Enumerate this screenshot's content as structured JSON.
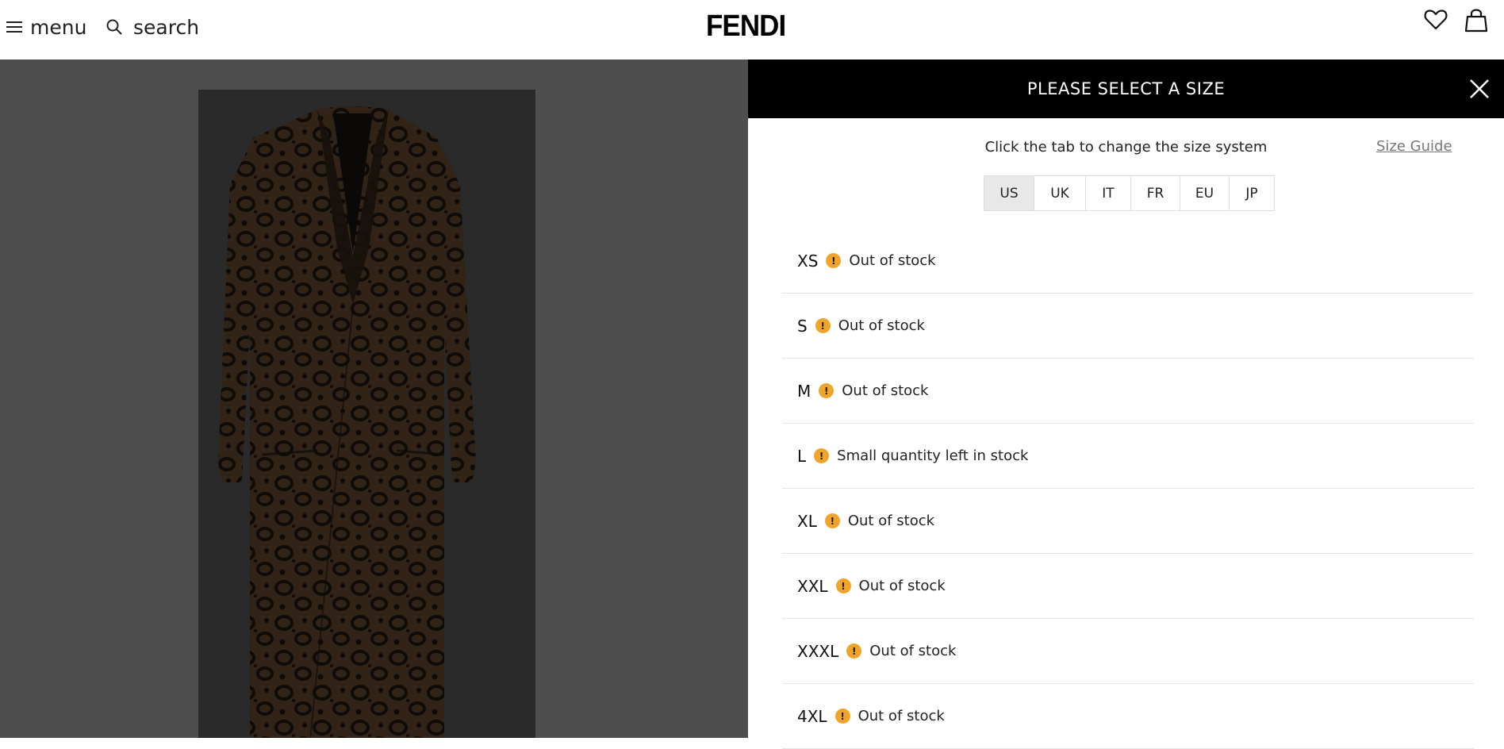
{
  "header": {
    "menu_label": "menu",
    "search_label": "search",
    "logo": "FENDI",
    "icons": [
      "menu-icon",
      "search-icon",
      "heart-icon",
      "bag-icon"
    ]
  },
  "panel": {
    "title": "PLEASE SELECT A SIZE",
    "instruction": "Click the tab to change the size system",
    "size_guide": "Size Guide",
    "tabs": [
      {
        "label": "US",
        "active": true
      },
      {
        "label": "UK",
        "active": false
      },
      {
        "label": "IT",
        "active": false
      },
      {
        "label": "FR",
        "active": false
      },
      {
        "label": "EU",
        "active": false
      },
      {
        "label": "JP",
        "active": false
      }
    ],
    "sizes": [
      {
        "size": "XS",
        "status": "Out of stock"
      },
      {
        "size": "S",
        "status": "Out of stock"
      },
      {
        "size": "M",
        "status": "Out of stock"
      },
      {
        "size": "L",
        "status": "Small quantity left in stock"
      },
      {
        "size": "XL",
        "status": "Out of stock"
      },
      {
        "size": "XXL",
        "status": "Out of stock"
      },
      {
        "size": "XXXL",
        "status": "Out of stock"
      },
      {
        "size": "4XL",
        "status": "Out of stock"
      }
    ],
    "status_icon": "!"
  },
  "colors": {
    "panel_header": "#000000",
    "warning": "#f0a52a",
    "overlay": "#4e4e4e",
    "active_tab": "#e8e8e8"
  }
}
